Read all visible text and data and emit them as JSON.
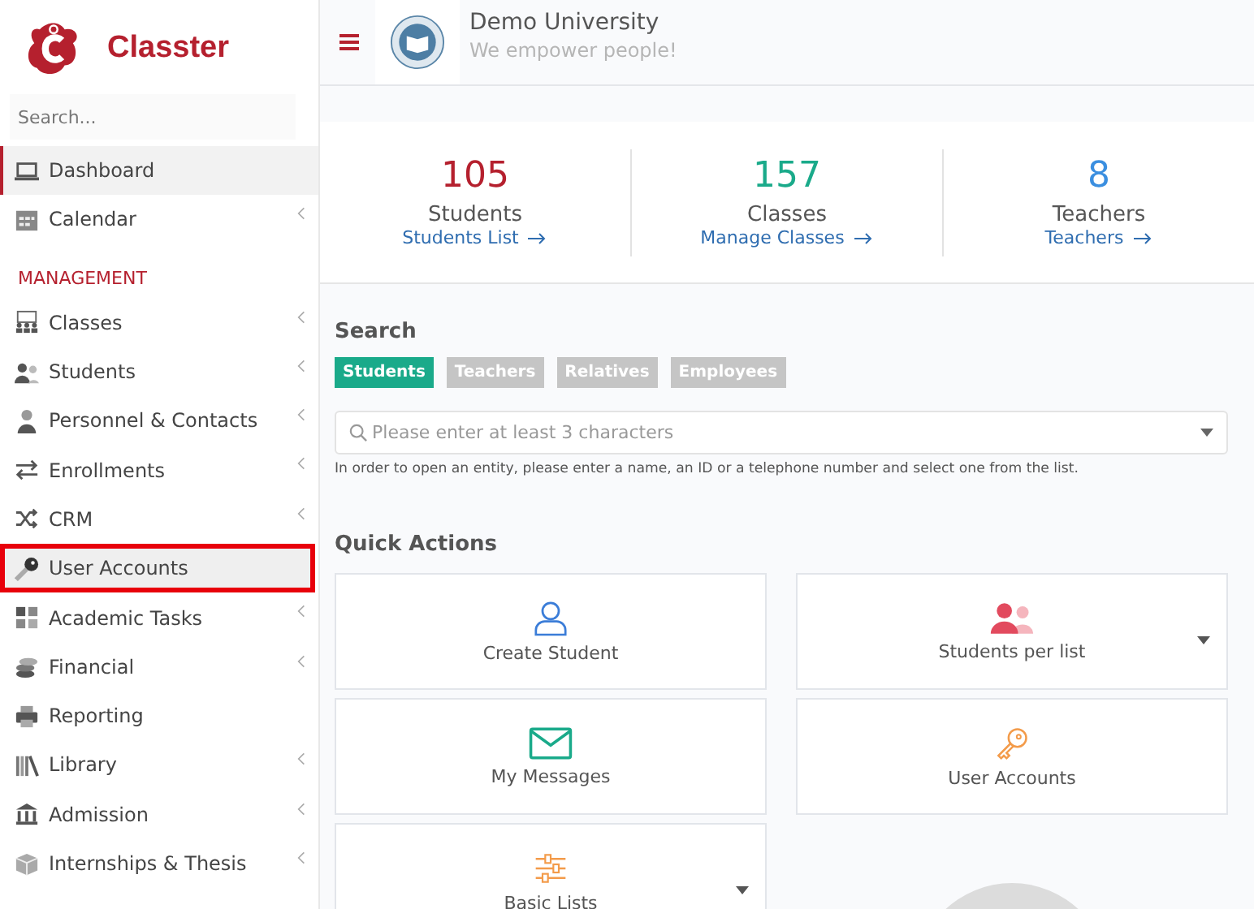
{
  "brand": {
    "name": "Classter"
  },
  "sidebar": {
    "search": {
      "placeholder": "Search..."
    },
    "items": [
      {
        "label": "Dashboard",
        "selected": true,
        "highlighted": false,
        "expandable": false
      },
      {
        "label": "Calendar",
        "selected": false,
        "highlighted": false,
        "expandable": true
      }
    ],
    "section": "MANAGEMENT",
    "management_items": [
      {
        "label": "Classes",
        "selected": false,
        "highlighted": false,
        "expandable": true
      },
      {
        "label": "Students",
        "selected": false,
        "highlighted": false,
        "expandable": true
      },
      {
        "label": "Personnel & Contacts",
        "selected": false,
        "highlighted": false,
        "expandable": true
      },
      {
        "label": "Enrollments",
        "selected": false,
        "highlighted": false,
        "expandable": true
      },
      {
        "label": "CRM",
        "selected": false,
        "highlighted": false,
        "expandable": true
      },
      {
        "label": "User Accounts",
        "selected": false,
        "highlighted": true,
        "expandable": false
      },
      {
        "label": "Academic Tasks",
        "selected": false,
        "highlighted": false,
        "expandable": true
      },
      {
        "label": "Financial",
        "selected": false,
        "highlighted": false,
        "expandable": true
      },
      {
        "label": "Reporting",
        "selected": false,
        "highlighted": false,
        "expandable": false
      },
      {
        "label": "Library",
        "selected": false,
        "highlighted": false,
        "expandable": true
      },
      {
        "label": "Admission",
        "selected": false,
        "highlighted": false,
        "expandable": true
      },
      {
        "label": "Internships & Thesis",
        "selected": false,
        "highlighted": false,
        "expandable": true
      }
    ]
  },
  "header": {
    "title": "Demo University",
    "subtitle": "We empower people!"
  },
  "stats": [
    {
      "value": "105",
      "color": "#b5202e",
      "label": "Students",
      "link": "Students List"
    },
    {
      "value": "157",
      "color": "#1aaa8a",
      "label": "Classes",
      "link": "Manage Classes"
    },
    {
      "value": "8",
      "color": "#3b8fe0",
      "label": "Teachers",
      "link": "Teachers"
    }
  ],
  "search": {
    "heading": "Search",
    "tabs": [
      {
        "label": "Students",
        "selected": true
      },
      {
        "label": "Teachers",
        "selected": false
      },
      {
        "label": "Relatives",
        "selected": false
      },
      {
        "label": "Employees",
        "selected": false
      }
    ],
    "placeholder": "Please enter at least 3 characters",
    "hint": "In order to open an entity, please enter a name, an ID or a telephone number and select one from the list."
  },
  "quick_actions": {
    "heading": "Quick Actions",
    "items": [
      {
        "label": "Create Student",
        "dropdown": false
      },
      {
        "label": "Students per list",
        "dropdown": true
      },
      {
        "label": "My Messages",
        "dropdown": false
      },
      {
        "label": "User Accounts",
        "dropdown": false
      },
      {
        "label": "Basic Lists",
        "dropdown": true
      }
    ]
  }
}
